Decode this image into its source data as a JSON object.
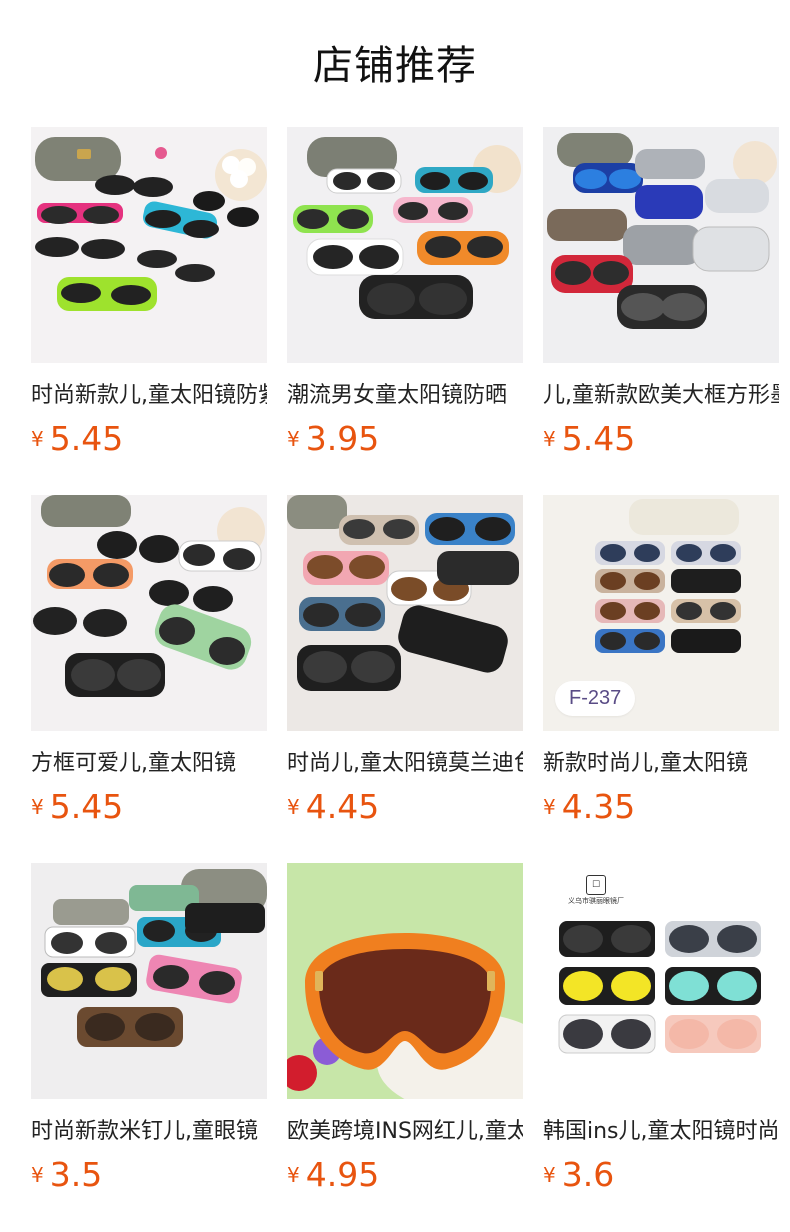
{
  "header": {
    "title": "店铺推荐"
  },
  "currency_symbol": "¥",
  "products": [
    {
      "name": "时尚新款儿,童太阳镜防紫外线",
      "price": "5.45",
      "image_icon": "sunglasses-assortment-image"
    },
    {
      "name": "潮流男女童太阳镜防晒",
      "price": "3.95",
      "image_icon": "sunglasses-assortment-image"
    },
    {
      "name": "儿,童新款欧美大框方形墨镜",
      "price": "5.45",
      "image_icon": "sunglasses-assortment-image"
    },
    {
      "name": "方框可爱儿,童太阳镜",
      "price": "5.45",
      "image_icon": "sunglasses-assortment-image"
    },
    {
      "name": "时尚儿,童太阳镜莫兰迪色",
      "price": "4.45",
      "image_icon": "sunglasses-assortment-image"
    },
    {
      "name": "新款时尚儿,童太阳镜",
      "price": "4.35",
      "image_icon": "sunglasses-assortment-image",
      "badge": "F-237"
    },
    {
      "name": "时尚新款米钉儿,童眼镜",
      "price": "3.5",
      "image_icon": "sunglasses-assortment-image"
    },
    {
      "name": "欧美跨境INS网红儿,童太阳镜",
      "price": "4.95",
      "image_icon": "sunglasses-single-image"
    },
    {
      "name": "韩国ins儿,童太阳镜时尚",
      "price": "3.6",
      "image_icon": "sunglasses-assortment-image",
      "brand_caption": "义乌市骐丽眼镜厂"
    }
  ]
}
